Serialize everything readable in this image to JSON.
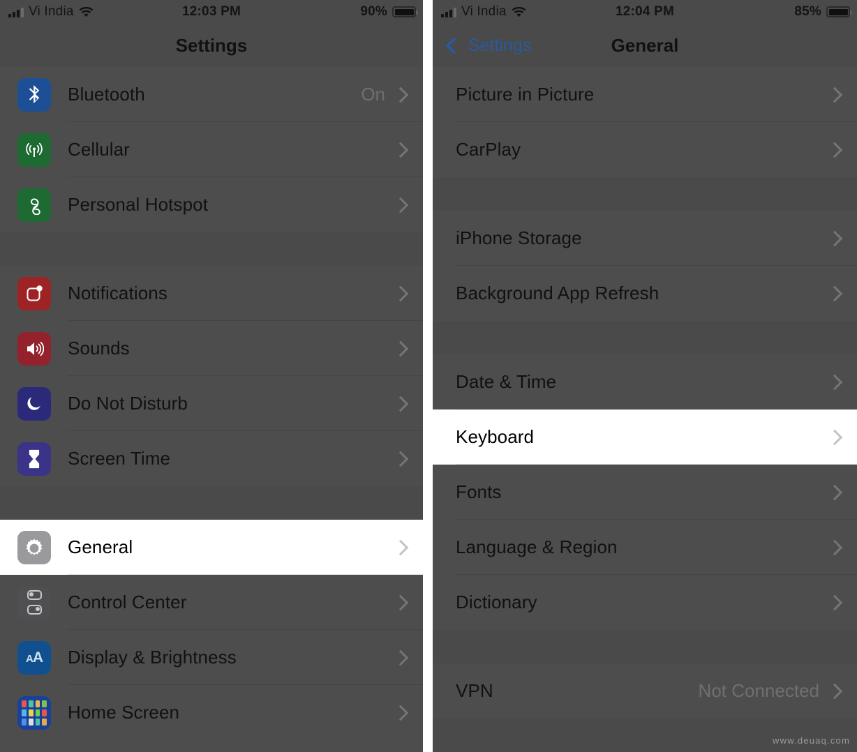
{
  "left_screen": {
    "status_bar": {
      "carrier": "Vi India",
      "time": "12:03 PM",
      "battery_percent": "90%",
      "signal_icon": "signal-bars-icon",
      "wifi_icon": "wifi-icon",
      "battery_icon": "battery-icon"
    },
    "nav": {
      "title": "Settings"
    },
    "groups": [
      {
        "rows": [
          {
            "icon": "bluetooth-icon",
            "icon_class": "ic-bluetooth",
            "label": "Bluetooth",
            "value": "On",
            "chevron": true,
            "highlight": false
          },
          {
            "icon": "cellular-icon",
            "icon_class": "ic-cellular",
            "label": "Cellular",
            "value": "",
            "chevron": true,
            "highlight": false
          },
          {
            "icon": "personal-hotspot-icon",
            "icon_class": "ic-hotspot",
            "label": "Personal Hotspot",
            "value": "",
            "chevron": true,
            "highlight": false
          }
        ]
      },
      {
        "rows": [
          {
            "icon": "notifications-icon",
            "icon_class": "ic-notifications",
            "label": "Notifications",
            "value": "",
            "chevron": true,
            "highlight": false
          },
          {
            "icon": "sounds-icon",
            "icon_class": "ic-sounds",
            "label": "Sounds",
            "value": "",
            "chevron": true,
            "highlight": false
          },
          {
            "icon": "do-not-disturb-icon",
            "icon_class": "ic-dnd",
            "label": "Do Not Disturb",
            "value": "",
            "chevron": true,
            "highlight": false
          },
          {
            "icon": "screen-time-icon",
            "icon_class": "ic-screentime",
            "label": "Screen Time",
            "value": "",
            "chevron": true,
            "highlight": false
          }
        ]
      },
      {
        "rows": [
          {
            "icon": "general-gear-icon",
            "icon_class": "ic-general",
            "label": "General",
            "value": "",
            "chevron": true,
            "highlight": true
          },
          {
            "icon": "control-center-icon",
            "icon_class": "ic-controlcenter",
            "label": "Control Center",
            "value": "",
            "chevron": true,
            "highlight": false
          },
          {
            "icon": "display-brightness-icon",
            "icon_class": "ic-display",
            "label": "Display & Brightness",
            "value": "",
            "chevron": true,
            "highlight": false
          },
          {
            "icon": "home-screen-icon",
            "icon_class": "ic-homescreen",
            "label": "Home Screen",
            "value": "",
            "chevron": true,
            "highlight": false
          }
        ]
      }
    ]
  },
  "right_screen": {
    "status_bar": {
      "carrier": "Vi India",
      "time": "12:04 PM",
      "battery_percent": "85%",
      "signal_icon": "signal-bars-icon",
      "wifi_icon": "wifi-icon",
      "battery_icon": "battery-icon"
    },
    "nav": {
      "back_label": "Settings",
      "title": "General",
      "back_icon": "chevron-left-icon"
    },
    "groups": [
      {
        "rows": [
          {
            "label": "Picture in Picture",
            "value": "",
            "chevron": true,
            "highlight": false
          },
          {
            "label": "CarPlay",
            "value": "",
            "chevron": true,
            "highlight": false
          }
        ]
      },
      {
        "rows": [
          {
            "label": "iPhone Storage",
            "value": "",
            "chevron": true,
            "highlight": false
          },
          {
            "label": "Background App Refresh",
            "value": "",
            "chevron": true,
            "highlight": false
          }
        ]
      },
      {
        "rows": [
          {
            "label": "Date & Time",
            "value": "",
            "chevron": true,
            "highlight": false
          },
          {
            "label": "Keyboard",
            "value": "",
            "chevron": true,
            "highlight": true
          },
          {
            "label": "Fonts",
            "value": "",
            "chevron": true,
            "highlight": false
          },
          {
            "label": "Language & Region",
            "value": "",
            "chevron": true,
            "highlight": false
          },
          {
            "label": "Dictionary",
            "value": "",
            "chevron": true,
            "highlight": false
          }
        ]
      },
      {
        "rows": [
          {
            "label": "VPN",
            "value": "Not Connected",
            "chevron": true,
            "highlight": false
          }
        ]
      }
    ]
  },
  "watermark": "www.deuaq.com",
  "colors": {
    "dim_overlay_row": "#4d4d4d",
    "dim_overlay_spacer": "#4a4a4a",
    "highlight_row": "#ffffff",
    "accent_blue": "#2a5a9c",
    "value_gray": "#6f6f6f"
  }
}
